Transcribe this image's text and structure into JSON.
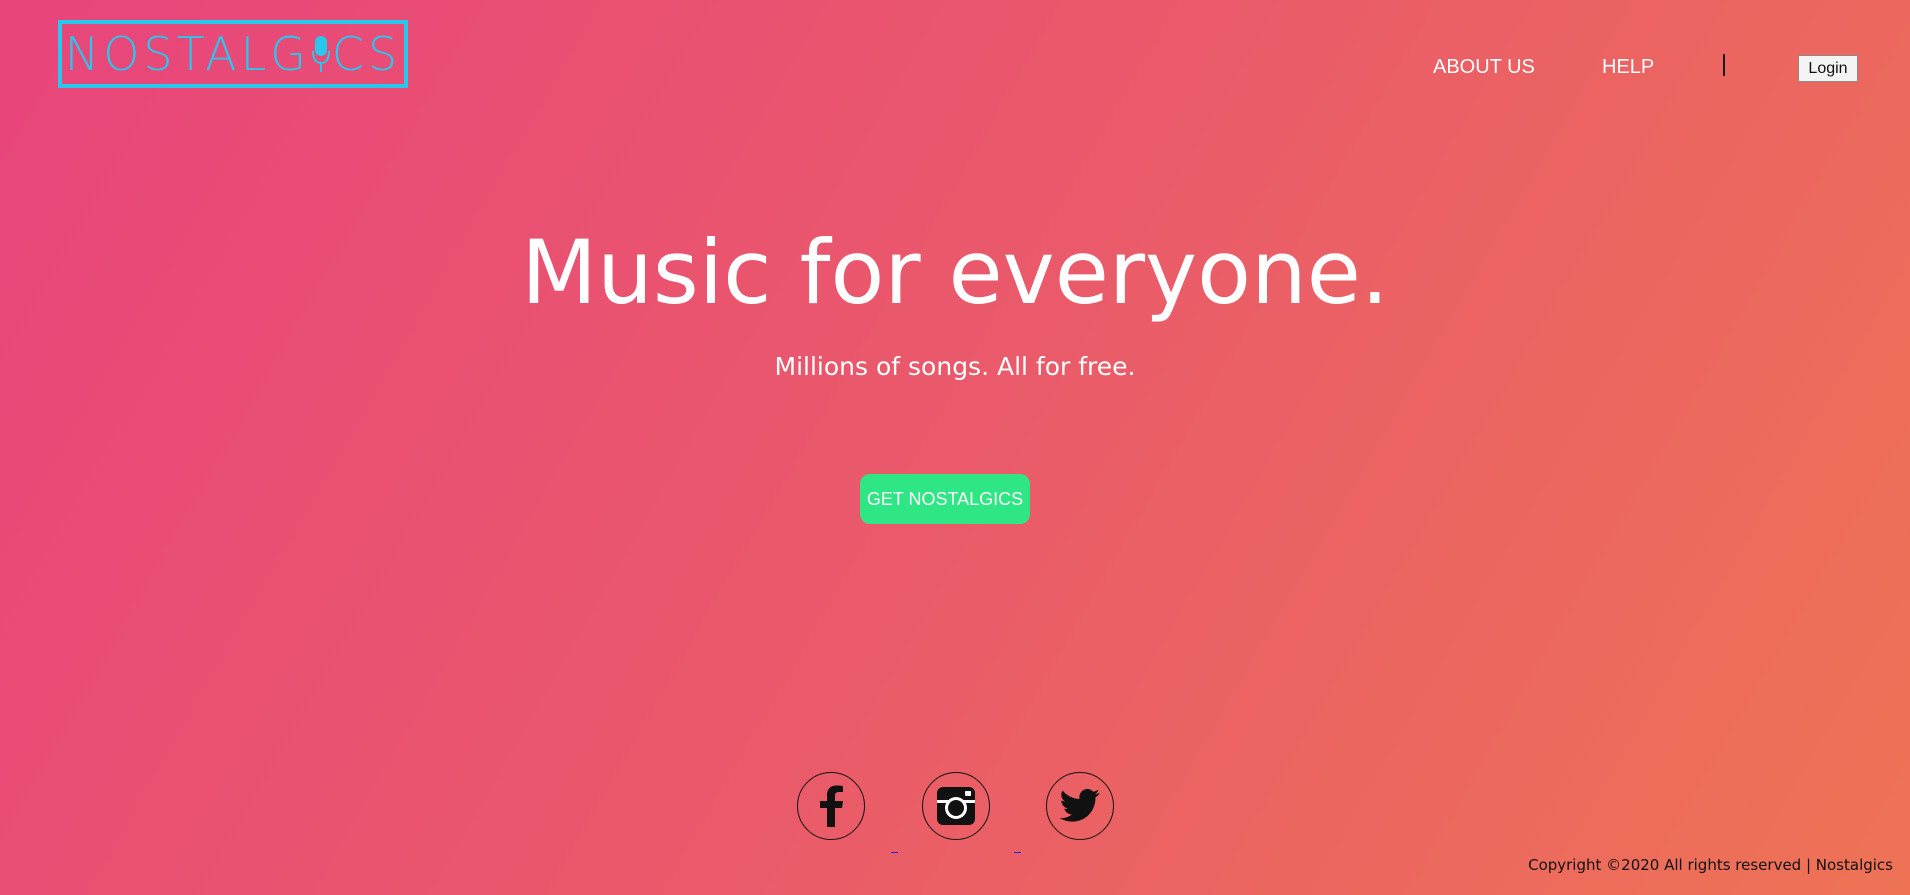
{
  "brand": {
    "logo_text_left": "NOSTALG",
    "logo_text_right": "CS",
    "logo_color": "#29c6ee"
  },
  "nav": {
    "about_label": "ABOUT US",
    "help_label": "HELP",
    "separator": "|",
    "login_label": "Login"
  },
  "hero": {
    "title": "Music for everyone.",
    "subtitle": "Millions of songs. All for free.",
    "cta_label": "GET NOSTALGICS",
    "cta_color": "#2ee784"
  },
  "social": {
    "items": [
      {
        "icon": "facebook-icon"
      },
      {
        "icon": "instagram-icon"
      },
      {
        "icon": "twitter-icon"
      }
    ]
  },
  "footer": {
    "copyright": "Copyright ©2020 All rights reserved | Nostalgics"
  },
  "colors": {
    "background_start": "#e8457b",
    "background_end": "#ee7355"
  }
}
